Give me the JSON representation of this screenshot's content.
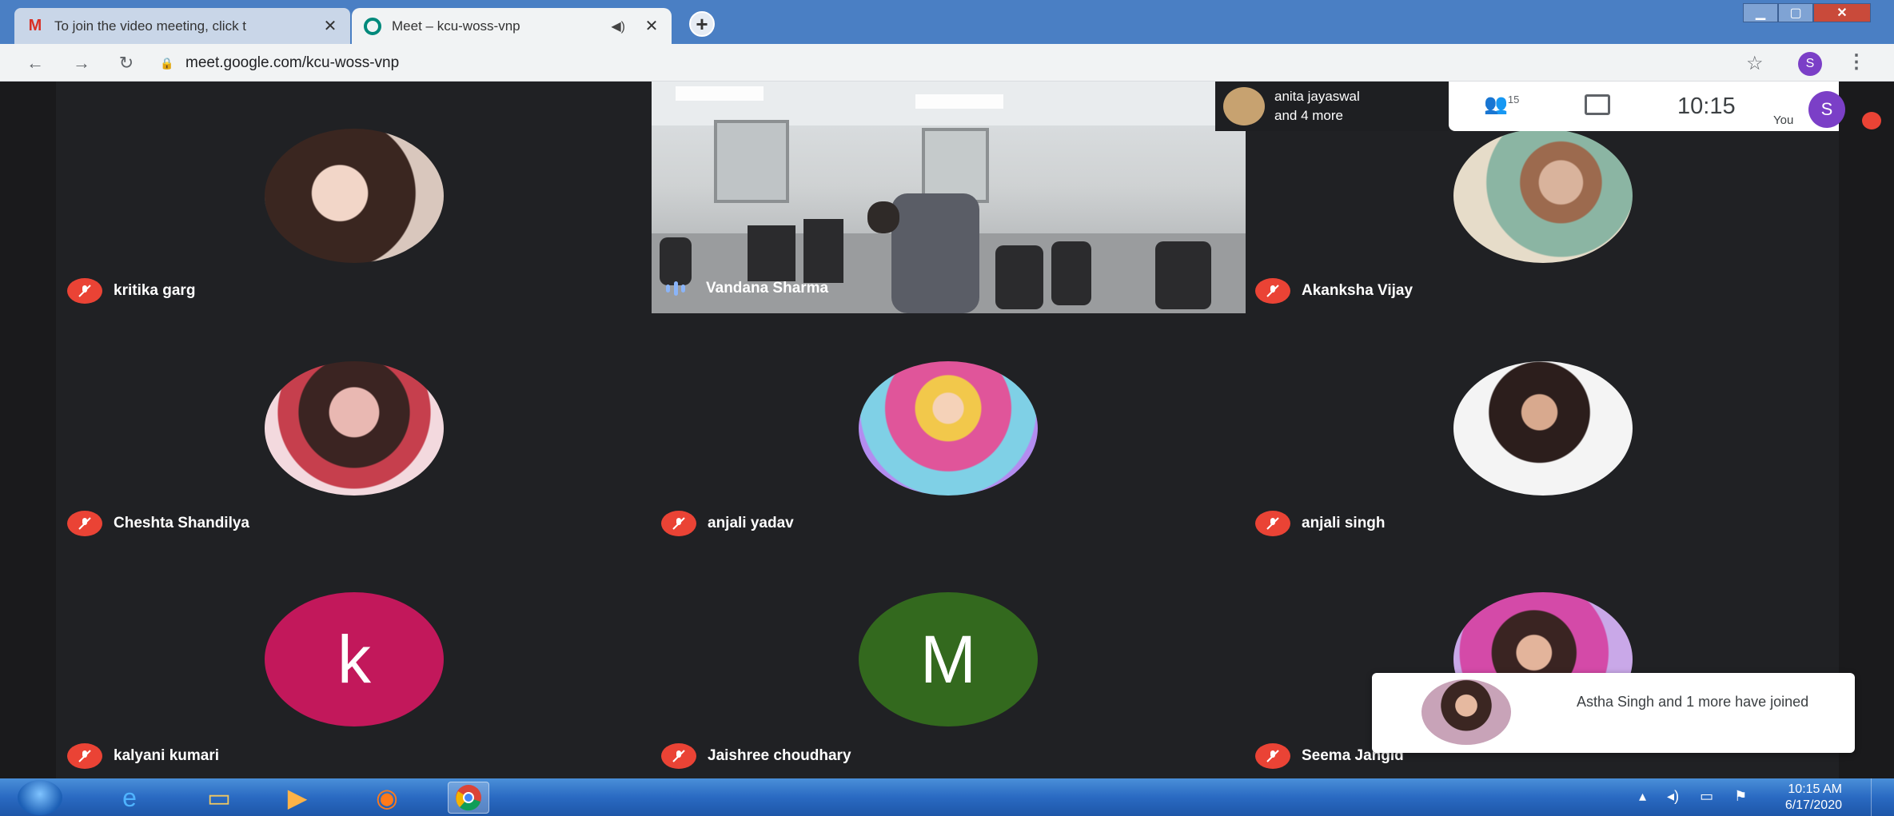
{
  "browser": {
    "tabs": [
      {
        "title": "To join the video meeting, click t",
        "favicon": "gmail-icon",
        "active": false
      },
      {
        "title": "Meet – kcu-woss-vnp",
        "favicon": "meet-icon",
        "active": true
      }
    ],
    "url": "meet.google.com/kcu-woss-vnp",
    "profile_initial": "S"
  },
  "meeting": {
    "presenter": {
      "line1": "anita jayaswal",
      "line2": "and 4 more"
    },
    "participant_count": "15",
    "time": "10:15",
    "you_label": "You",
    "you_initial": "S",
    "participants": [
      {
        "name": "kritika garg",
        "type": "photo",
        "muted": true
      },
      {
        "name": "Vandana Sharma",
        "type": "video",
        "muted": false
      },
      {
        "name": "Akanksha Vijay",
        "type": "photo",
        "muted": true
      },
      {
        "name": "Cheshta Shandilya",
        "type": "photo",
        "muted": true
      },
      {
        "name": "anjali yadav",
        "type": "photo",
        "muted": true
      },
      {
        "name": "anjali singh",
        "type": "photo",
        "muted": true
      },
      {
        "name": "kalyani kumari",
        "type": "letter",
        "letter": "k",
        "color": "#c2185b",
        "muted": true
      },
      {
        "name": "Jaishree choudhary",
        "type": "letter",
        "letter": "M",
        "color": "#33691e",
        "muted": true
      },
      {
        "name": "Seema Jangid",
        "type": "photo",
        "muted": true
      }
    ],
    "toast": {
      "text": "Astha Singh and 1 more have joined"
    }
  },
  "taskbar": {
    "clock_time": "10:15 AM",
    "clock_date": "6/17/2020"
  },
  "colors": {
    "mic_off": "#ea4335",
    "stage_bg": "#202124",
    "accent": "#8ab4f8"
  }
}
